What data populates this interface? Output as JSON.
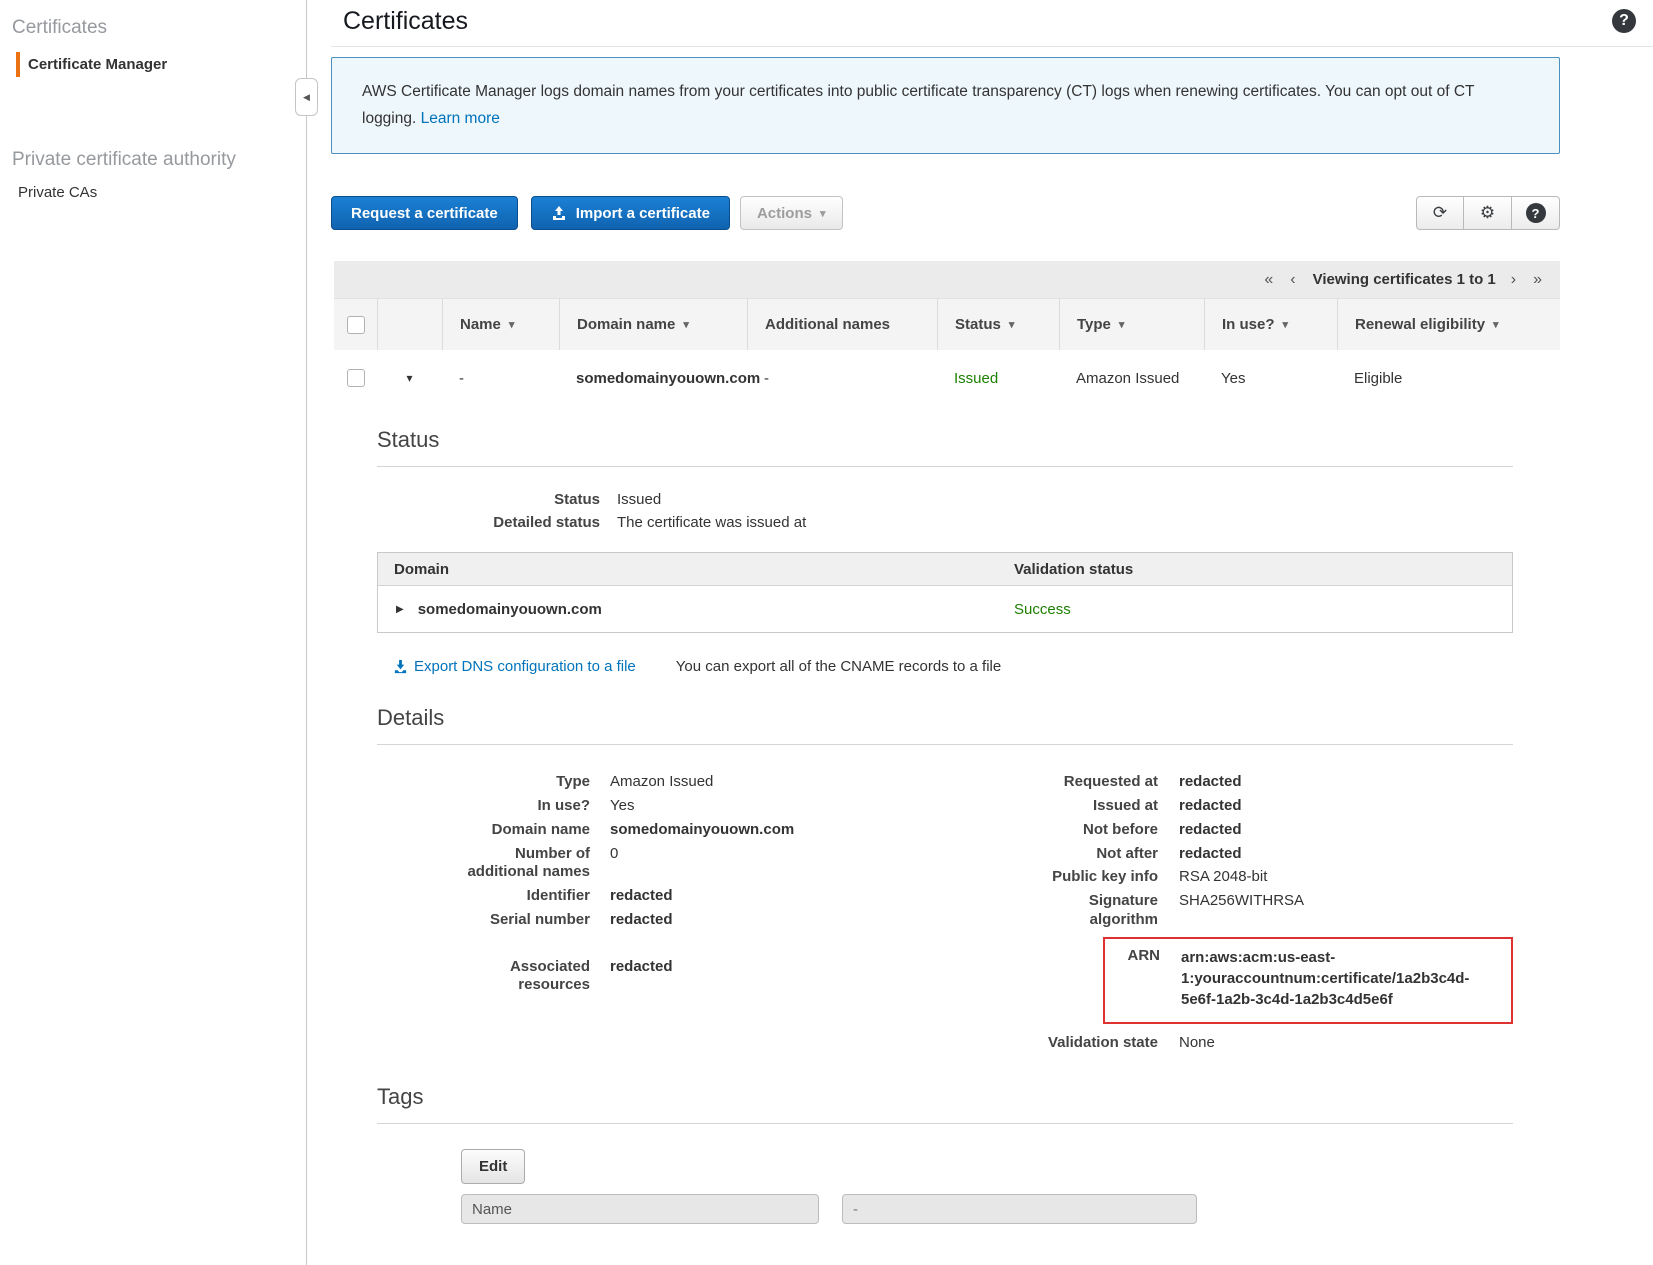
{
  "sidebar": {
    "section_certificates_title": "Certificates",
    "item_certificate_manager": "Certificate Manager",
    "section_private_ca_title": "Private certificate authority",
    "item_private_cas": "Private CAs"
  },
  "icons": {
    "collapse": "◀",
    "help": "?",
    "refresh": "⟳",
    "settings": "⚙",
    "caret_down": "▾",
    "sort": "▾",
    "row_expand": "▾",
    "domain_expand": "▶"
  },
  "header": {
    "title": "Certificates"
  },
  "banner": {
    "text": "AWS Certificate Manager logs domain names from your certificates into public certificate transparency (CT) logs when renewing certificates. You can opt out of CT logging. ",
    "link": "Learn more"
  },
  "toolbar": {
    "request_button": "Request a certificate",
    "import_button": "Import a certificate",
    "actions_button": "Actions"
  },
  "table": {
    "pagination": {
      "first": "«",
      "prev": "‹",
      "label": "Viewing certificates 1 to 1",
      "next": "›",
      "last": "»"
    },
    "columns": [
      {
        "label": "Name"
      },
      {
        "label": "Domain name"
      },
      {
        "label": "Additional names"
      },
      {
        "label": "Status"
      },
      {
        "label": "Type"
      },
      {
        "label": "In use?"
      },
      {
        "label": "Renewal eligibility"
      }
    ],
    "row": {
      "name": "-",
      "domain": "somedomainyouown.com",
      "additional": "-",
      "status": "Issued",
      "type": "Amazon Issued",
      "in_use": "Yes",
      "renewal": "Eligible"
    }
  },
  "status_section": {
    "heading": "Status",
    "status_label": "Status",
    "status_value": "Issued",
    "detailed_status_label": "Detailed status",
    "detailed_status_value": "The certificate was issued at",
    "domain_table": {
      "domain_header": "Domain",
      "validation_header": "Validation status",
      "domain": "somedomainyouown.com",
      "validation": "Success"
    },
    "export_link": "Export DNS configuration to a file",
    "export_hint": "You can export all of the CNAME records to a file"
  },
  "details_section": {
    "heading": "Details",
    "type_label": "Type",
    "type_value": "Amazon Issued",
    "in_use_label": "In use?",
    "in_use_value": "Yes",
    "domain_label": "Domain name",
    "domain_value": "somedomainyouown.com",
    "num_label_1": "Number of",
    "num_label_2": "additional names",
    "num_value": "0",
    "identifier_label": "Identifier",
    "identifier_value": "redacted",
    "serial_label": "Serial number",
    "serial_value": "redacted",
    "assoc_label_1": "Associated",
    "assoc_label_2": "resources",
    "assoc_value": "redacted",
    "requested_label": "Requested at",
    "requested_value": "redacted",
    "issued_label": "Issued at",
    "issued_value": "redacted",
    "not_before_label": "Not before",
    "not_before_value": "redacted",
    "not_after_label": "Not after",
    "not_after_value": "redacted",
    "public_key_label": "Public key info",
    "public_key_value": "RSA 2048-bit",
    "sig_label_1": "Signature",
    "sig_label_2": "algorithm",
    "sig_value": "SHA256WITHRSA",
    "arn_label": "ARN",
    "arn_value": "arn:aws:acm:us-east-1:youraccountnum:certificate/1a2b3c4d-5e6f-1a2b-3c4d-1a2b3c4d5e6f",
    "validation_state_label": "Validation state",
    "validation_state_value": "None"
  },
  "tags_section": {
    "heading": "Tags",
    "edit_button": "Edit",
    "tag_key": "Name",
    "tag_value": "-"
  },
  "colors": {
    "accent_blue": "#0073bb",
    "button_blue": "#1063b0",
    "success_green": "#1d8102",
    "active_orange": "#ec7211",
    "annotation_red": "#e03131",
    "banner_bg": "#eef7fc",
    "banner_border": "#4d90c0"
  }
}
